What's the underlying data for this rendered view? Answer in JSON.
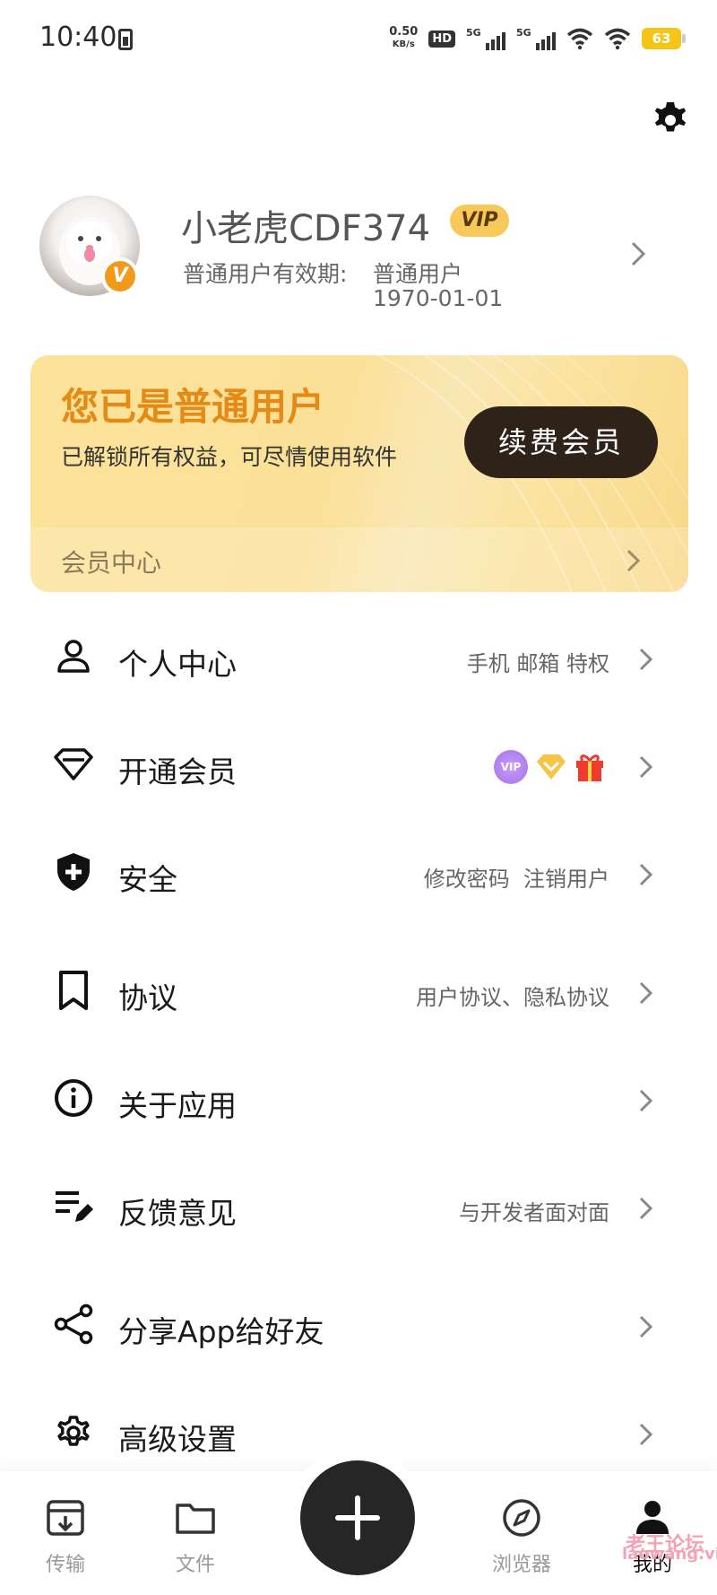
{
  "status_bar": {
    "time": "10:40",
    "net_speed_value": "0.50",
    "net_speed_unit": "KB/s",
    "hd": "HD",
    "signal1": "5G",
    "signal2": "5G",
    "battery": "63"
  },
  "profile": {
    "username": "小老虎CDF374",
    "vip_badge": "VIP",
    "avatar_badge": "V",
    "expiry_label": "普通用户有效期:",
    "expiry_value": "普通用户",
    "expiry_date": "1970-01-01"
  },
  "member_card": {
    "title": "您已是普通用户",
    "subtitle": "已解锁所有权益，可尽情使用软件",
    "renew_button": "续费会员",
    "footer_label": "会员中心"
  },
  "menu": {
    "personal": {
      "label": "个人中心",
      "sub": "手机 邮箱 特权",
      "icon": "person-icon"
    },
    "membership": {
      "label": "开通会员",
      "badge_vip": "VIP",
      "icon": "diamond-icon"
    },
    "security": {
      "label": "安全",
      "sub": "修改密码  注销用户",
      "icon": "shield-icon"
    },
    "agreement": {
      "label": "协议",
      "sub": "用户协议、隐私协议",
      "icon": "bookmark-icon"
    },
    "about": {
      "label": "关于应用",
      "icon": "info-icon"
    },
    "feedback": {
      "label": "反馈意见",
      "sub": "与开发者面对面",
      "icon": "edit-list-icon"
    },
    "share": {
      "label": "分享App给好友",
      "icon": "share-icon"
    },
    "advanced": {
      "label": "高级设置",
      "icon": "gear-icon"
    }
  },
  "bottom_nav": {
    "transfer": "传输",
    "files": "文件",
    "browser": "浏览器",
    "mine": "我的"
  },
  "watermark": {
    "top": "老王论坛",
    "bottom": "laowang.vip"
  },
  "colors": {
    "accent_orange": "#e38a17",
    "card_bg": "#fde39a",
    "renew_button_bg": "#2f2218",
    "vip_badge_bg": "#f7c95b"
  }
}
